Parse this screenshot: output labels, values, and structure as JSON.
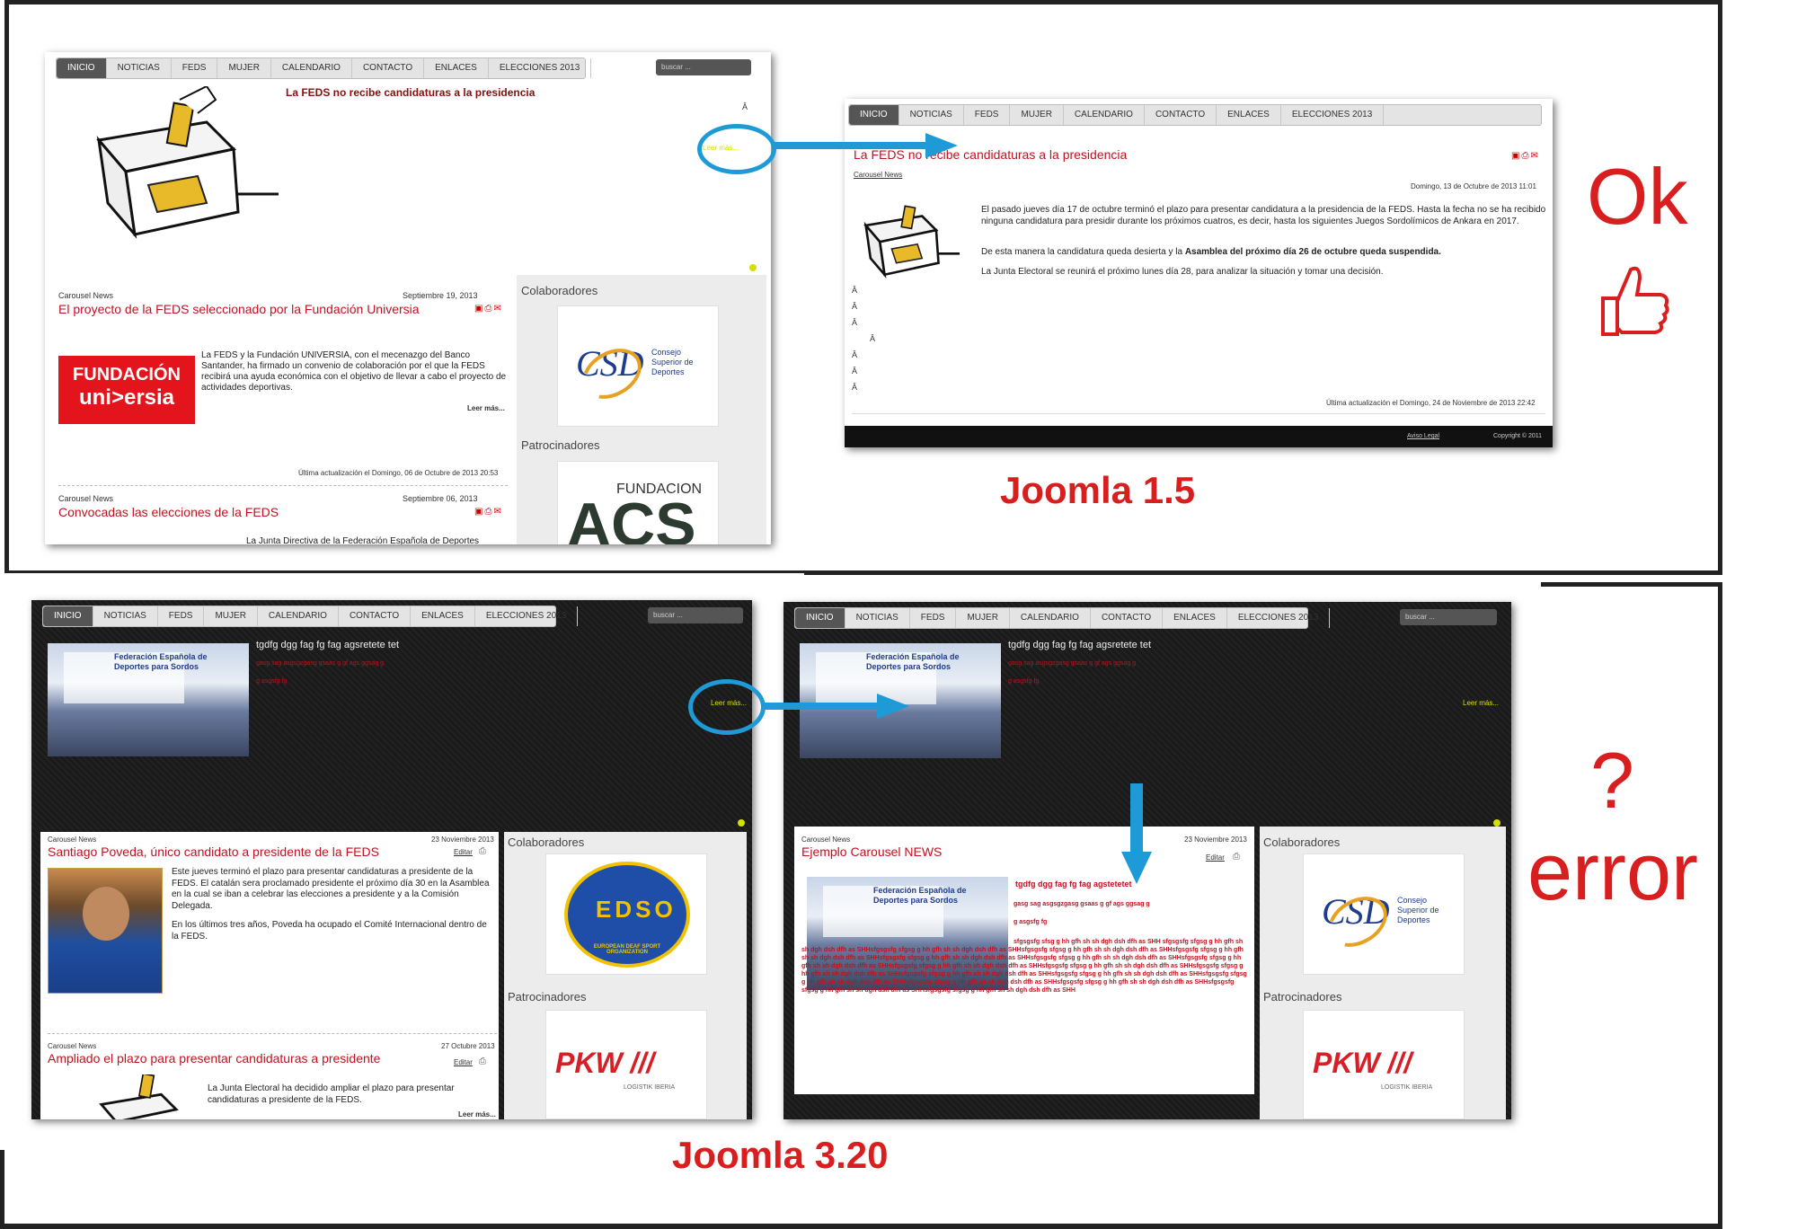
{
  "nav": [
    "INICIO",
    "NOTICIAS",
    "FEDS",
    "MUJER",
    "CALENDARIO",
    "CONTACTO",
    "ENLACES",
    "ELECCIONES 2013"
  ],
  "search_placeholder": "buscar ...",
  "top_left": {
    "headline": "La FEDS no recibe candidaturas a la presidencia",
    "readmore": "Leer más...",
    "a_char": "Â",
    "article1": {
      "category": "Carousel News",
      "date": "Septiembre 19, 2013",
      "title": "El proyecto de la FEDS seleccionado por la Fundación Universia",
      "text": "La FEDS y la Fundación UNIVERSIA, con el mecenazgo del Banco Santander, ha firmado un convenio de colaboración por el que la FEDS recibirá una ayuda económica con el objetivo de llevar a cabo el proyecto de actividades deportivas.",
      "readmore": "Leer más...",
      "updated": "Última actualización el Domingo, 06 de Octubre de 2013 20:53"
    },
    "article2": {
      "category": "Carousel News",
      "date": "Septiembre 06, 2013",
      "title": "Convocadas las elecciones de la FEDS",
      "text": "La Junta Directiva de la Federación Española de Deportes"
    },
    "sidebar": {
      "collab": "Colaboradores",
      "sponsors": "Patrocinadores"
    },
    "universia": {
      "line1": "FUNDACIÓN",
      "line2": "uni>ersia"
    },
    "csd": {
      "mark": "CSD",
      "text": "Consejo Superior de Deportes"
    },
    "acs": {
      "line1": "FUNDACION",
      "line2": "ACS"
    }
  },
  "top_right": {
    "title": "La FEDS no recibe candidaturas a la presidencia",
    "category": "Carousel News",
    "date": "Domingo, 13 de Octubre de 2013 11:01",
    "p1": "El pasado jueves día 17 de octubre terminó el plazo para presentar candidatura a la presidencia de la FEDS. Hasta la fecha no se ha recibido ninguna candidatura para presidir durante los próximos cuatros, es decir, hasta los siguientes Juegos Sordolímicos de Ankara en 2017.",
    "p2a": "De esta manera la candidatura queda desierta y la ",
    "p2b": "Asamblea del próximo día 26 de octubre queda suspendida.",
    "p3": "La Junta Electoral se reunirá el próximo lunes día 28, para analizar la situación y tomar una decisión.",
    "updated": "Última actualización el Domingo, 24 de Noviembre de 2013 22:42",
    "footer_legal": "Aviso Legal",
    "footer_copy": "Copyright © 2011"
  },
  "bottom_left": {
    "slide_title": "tgdfg dgg fag fg fag agsretete tet",
    "slide_red1": "gasg sag asgsgzgasg gsaas g gf ags ggsag g",
    "slide_red2": "g asgsfg fg",
    "readmore": "Leer más...",
    "article1": {
      "category": "Carousel News",
      "date": "23 Noviembre 2013",
      "title": "Santiago Poveda, único candidato a presidente de la FEDS",
      "edit": "Editar",
      "p1": "Este jueves terminó el plazo para presentar candidaturas a presidente de la FEDS. El catalán sera proclamado presidente el próximo día 30 en la Asamblea en la cual se iban a celebrar las elecciones a presidente y a la Comisión Delegada.",
      "p2": "En los últimos tres años, Poveda ha ocupado el Comité Internacional dentro de la FEDS."
    },
    "article2": {
      "category": "Carousel News",
      "date": "27 Octubre 2013",
      "title": "Ampliado el plazo para presentar candidaturas a presidente",
      "edit": "Editar",
      "text": "La Junta Electoral ha decidido ampliar el plazo para presentar candidaturas a presidente de la FEDS.",
      "readmore": "Leer más..."
    },
    "sidebar": {
      "collab": "Colaboradores",
      "sponsors": "Patrocinadores"
    },
    "edso": {
      "ring": "EUROPEAN DEAF SPORT ORGANIZATION",
      "letters": "EDSO"
    },
    "pkw": {
      "name": "PKW ///",
      "sub": "LOGISTIK IBERIA"
    },
    "photo_banner": "Federación Española de Deportes para Sordos"
  },
  "bottom_right": {
    "slide_title": "tgdfg dgg fag fg fag agsretete tet",
    "slide_red1": "gasg sag asgsgzgasg gsaas g gf ags ggsag g",
    "slide_red2": "g asgsfg fg",
    "readmore": "Leer más...",
    "article": {
      "category": "Carousel News",
      "date": "23 Noviembre 2013",
      "title": "Ejemplo Carousel NEWS",
      "edit": "Editar",
      "inner_title": "tgdfg dgg fag fg fag agstetetet",
      "inner_red1": "gasg sag asgsgzgasg gsaas g gf ags ggsag g",
      "inner_red2": "g asgsfg fg",
      "filler": "sfgsgsfg sfsg g hh gfh sh sh dgh dsh dfh as SHH sfgsgsfg sfgsg g hh gfh sh sh dgh dsh dfh as SHHsfgsgsfg sfgsg g hh gfh sh sh dgh dsh dfh as SHHsfgsgsfg sfgsg g hh gfh sh sh dgh dsh dfh as SHHsfgsgsfg sfgsg g hh gfh sh sh dgh dsh dfh as SHHsfgsgsfg sfgsg g hh gfh sh sh dgh dsh dfh as SHHsfgsgsfg sfgsg g hh gfh sh sh dgh dsh dfh as SHHsfgsgsfg sfgsg g hh gfh sh sh dgh dsh dfh as SHHsfgsgsfg sfgsg g hh gfh sh sh dgh dsh dfh as SHHsfgsgsfg sfgsg g hh gfh sh sh dgh dsh dfh as SHHsfgsgsfg sfgsg g hh gfh sh sh dgh dsh dfh as SHHsfgsgsfg sfgsg g hh gfh sh sh dgh dsh dfh as SHHsfgsgsfg sfgsg g hh gfh sh sh dgh dsh dfh as SHHsfgsgsfg sfgsg g hh gfh sh sh dgh dsh dfh as SHHsfgsgsfg sfgsg g hh gfh sh sh dgh dsh dfh as SHHsfgsgsfg sfgsg g hh gfh sh sh dgh dsh dfh as SHHsfgsgsfg sfgsg g hh gfh sh sh dgh dsh dfh as SHHsfgsgsfg sfgsg g hh gfh sh sh dgh dsh dfh as SHH"
    },
    "sidebar": {
      "collab": "Colaboradores",
      "sponsors": "Patrocinadores"
    }
  },
  "labels": {
    "ok": "Ok",
    "joomla15": "Joomla 1.5",
    "question": "?",
    "error": "error",
    "joomla320": "Joomla 3.20"
  },
  "colors": {
    "annotation_red": "#d81e1e",
    "arrow_blue": "#1e9ad6",
    "link_red": "#c0121f"
  }
}
